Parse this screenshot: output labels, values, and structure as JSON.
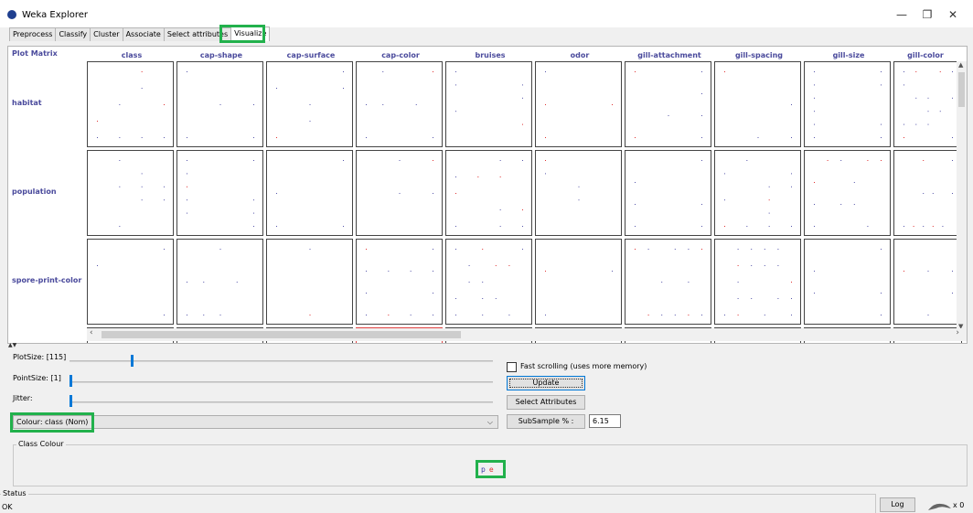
{
  "window": {
    "title": "Weka Explorer",
    "minimize": "—",
    "maximize": "❐",
    "close": "✕"
  },
  "tabs": [
    {
      "label": "Preprocess"
    },
    {
      "label": "Classify"
    },
    {
      "label": "Cluster"
    },
    {
      "label": "Associate"
    },
    {
      "label": "Select attributes"
    },
    {
      "label": "Visualize"
    }
  ],
  "plot_matrix": {
    "title": "Plot Matrix",
    "columns": [
      "class",
      "cap-shape",
      "cap-surface",
      "cap-color",
      "bruises",
      "odor",
      "gill-attachment",
      "gill-spacing",
      "gill-size",
      "gill-color"
    ],
    "rows": [
      "habitat",
      "population",
      "spore-print-color"
    ]
  },
  "controls": {
    "plot_size_label": "PlotSize: [115]",
    "point_size_label": "PointSize: [1]",
    "jitter_label": "Jitter:",
    "plot_size_value": 115,
    "point_size_value": 1,
    "colour_select": "Colour: class  (Nom)",
    "fast_scrolling_label": "Fast scrolling (uses more memory)",
    "fast_scrolling_checked": false,
    "update_button": "Update",
    "select_attributes_button": "Select Attributes",
    "subsample_label": "SubSample % :",
    "subsample_value": "6.15"
  },
  "class_colour": {
    "title": "Class Colour",
    "labels": [
      {
        "text": "p",
        "color": "#3a3aa8"
      },
      {
        "text": "e",
        "color": "#e03030"
      }
    ]
  },
  "status": {
    "title": "Status",
    "text": "OK",
    "log_button": "Log",
    "counter": "x 0"
  },
  "colors": {
    "accent_highlight": "#22b14c",
    "slider": "#0078d7",
    "header_text": "#4a4a9c",
    "selected_cell": "#e04040"
  }
}
